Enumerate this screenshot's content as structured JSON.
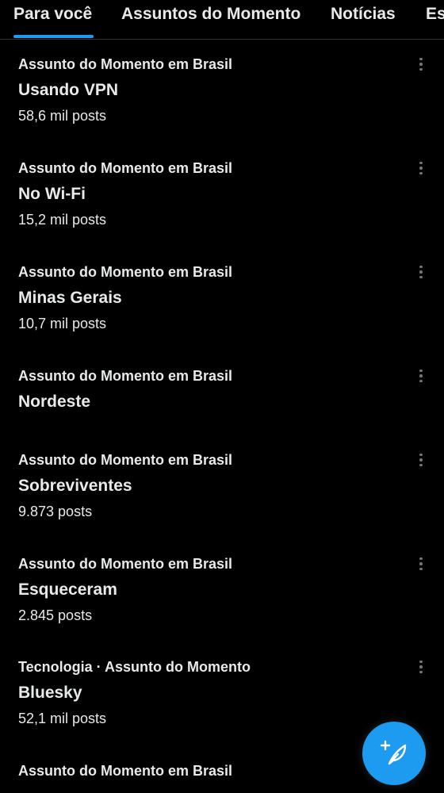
{
  "tabs": [
    {
      "label": "Para você",
      "active": true
    },
    {
      "label": "Assuntos do Momento",
      "active": false
    },
    {
      "label": "Notícias",
      "active": false
    },
    {
      "label": "Es",
      "active": false
    }
  ],
  "trends": [
    {
      "context": "Assunto do Momento em Brasil",
      "name": "Usando VPN",
      "count": "58,6 mil posts"
    },
    {
      "context": "Assunto do Momento em Brasil",
      "name": "No Wi-Fi",
      "count": "15,2 mil posts"
    },
    {
      "context": "Assunto do Momento em Brasil",
      "name": "Minas Gerais",
      "count": "10,7 mil posts"
    },
    {
      "context": "Assunto do Momento em Brasil",
      "name": "Nordeste",
      "count": ""
    },
    {
      "context": "Assunto do Momento em Brasil",
      "name": "Sobreviventes",
      "count": "9.873 posts"
    },
    {
      "context": "Assunto do Momento em Brasil",
      "name": "Esqueceram",
      "count": "2.845 posts"
    },
    {
      "context": "Tecnologia · Assunto do Momento",
      "name": "Bluesky",
      "count": "52,1 mil posts"
    },
    {
      "context": "Assunto do Momento em Brasil",
      "name": "",
      "count": ""
    }
  ],
  "icons": {
    "more": "more-options-icon",
    "compose": "compose-post-icon"
  },
  "colors": {
    "background": "#000000",
    "text": "#e7e9ea",
    "muted": "#71767b",
    "accent": "#1d9bf0",
    "divider": "#2f3336"
  }
}
